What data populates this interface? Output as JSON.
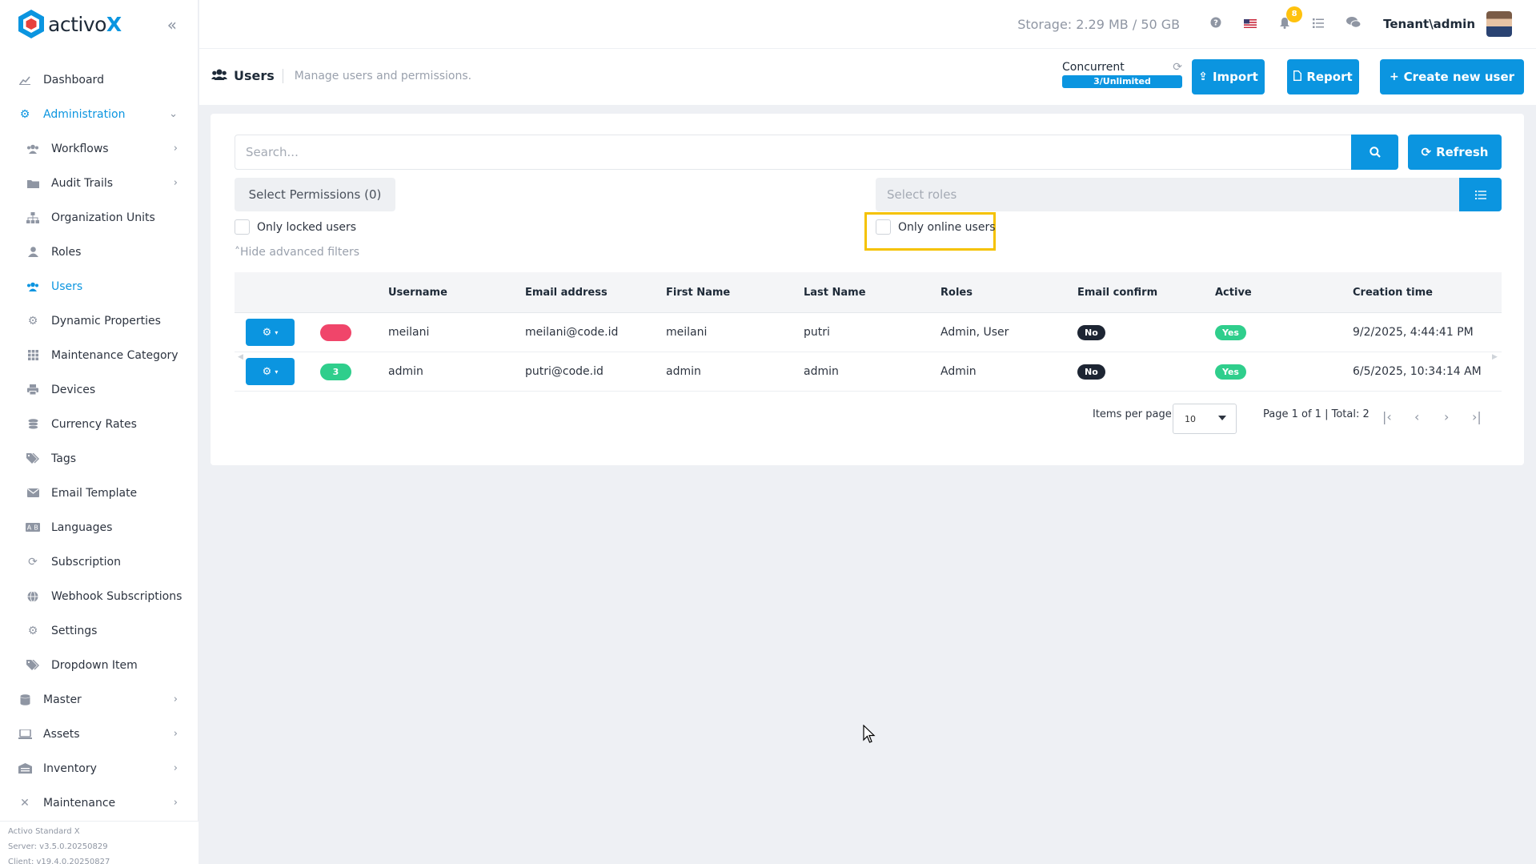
{
  "brand": {
    "name": "activo",
    "name_suffix": "X"
  },
  "sidebar": {
    "items": [
      {
        "label": "Dashboard",
        "icon": "chart-line-icon"
      },
      {
        "label": "Administration",
        "icon": "cogs-icon"
      },
      {
        "label": "Workflows",
        "icon": "users-icon"
      },
      {
        "label": "Audit Trails",
        "icon": "folder-icon"
      },
      {
        "label": "Organization Units",
        "icon": "sitemap-icon"
      },
      {
        "label": "Roles",
        "icon": "user-icon"
      },
      {
        "label": "Users",
        "icon": "users-icon"
      },
      {
        "label": "Dynamic Properties",
        "icon": "gear-icon"
      },
      {
        "label": "Maintenance Category",
        "icon": "grid-icon"
      },
      {
        "label": "Devices",
        "icon": "print-icon"
      },
      {
        "label": "Currency Rates",
        "icon": "coins-icon"
      },
      {
        "label": "Tags",
        "icon": "tags-icon"
      },
      {
        "label": "Email Template",
        "icon": "envelope-icon"
      },
      {
        "label": "Languages",
        "icon": "language-icon"
      },
      {
        "label": "Subscription",
        "icon": "sync-icon"
      },
      {
        "label": "Webhook Subscriptions",
        "icon": "globe-icon"
      },
      {
        "label": "Settings",
        "icon": "gear-icon"
      },
      {
        "label": "Dropdown Item",
        "icon": "tags-icon"
      },
      {
        "label": "Master",
        "icon": "database-icon"
      },
      {
        "label": "Assets",
        "icon": "laptop-icon"
      },
      {
        "label": "Inventory",
        "icon": "warehouse-icon"
      },
      {
        "label": "Maintenance",
        "icon": "tools-icon"
      }
    ],
    "footer": {
      "product": "Activo Standard X",
      "server": "Server: v3.5.0.20250829",
      "client": "Client: v19.4.0.20250827"
    }
  },
  "topbar": {
    "storage": "Storage: 2.29 MB / 50 GB",
    "notification_count": "8",
    "tenant": "Tenant\\admin"
  },
  "subheader": {
    "title": "Users",
    "description": "Manage users and permissions.",
    "concurrent_label": "Concurrent",
    "concurrent_value": "3/Unlimited",
    "import_label": "Import",
    "report_label": "Report",
    "create_label": "Create new user"
  },
  "filters": {
    "search_placeholder": "Search...",
    "refresh_label": "Refresh",
    "permissions_label": "Select Permissions (0)",
    "roles_placeholder": "Select roles",
    "only_locked_label": "Only locked users",
    "only_online_label": "Only online users",
    "hide_advanced_label": "Hide advanced filters"
  },
  "table": {
    "columns": [
      "Username",
      "Email address",
      "First Name",
      "Last Name",
      "Roles",
      "Email confirm",
      "Active",
      "Creation time"
    ],
    "rows": [
      {
        "pill_text": "",
        "pill_color": "#f0456a",
        "username": "meilani",
        "email": "meilani@code.id",
        "first_name": "meilani",
        "last_name": "putri",
        "roles": "Admin, User",
        "email_confirm": "No",
        "active": "Yes",
        "creation_time": "9/2/2025, 4:44:41 PM"
      },
      {
        "pill_text": "3",
        "pill_color": "#2fce8c",
        "username": "admin",
        "email": "putri@code.id",
        "first_name": "admin",
        "last_name": "admin",
        "roles": "Admin",
        "email_confirm": "No",
        "active": "Yes",
        "creation_time": "6/5/2025, 10:34:14 AM"
      }
    ]
  },
  "pagination": {
    "items_per_page_label": "Items per page",
    "items_per_page_value": "10",
    "summary": "Page 1 of 1 | Total: 2"
  },
  "colors": {
    "accent": "#0b95e0",
    "highlight": "#f5c200"
  }
}
